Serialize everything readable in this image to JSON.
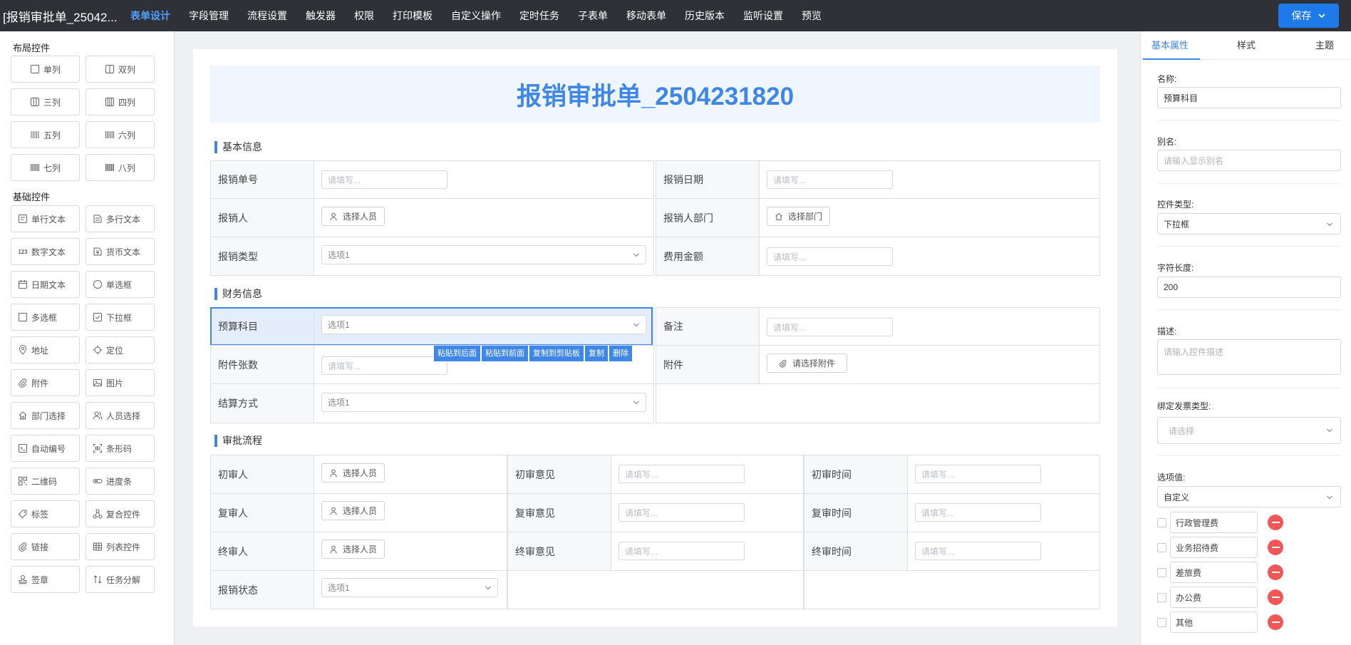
{
  "app": {
    "title": "[报销审批单_25042..."
  },
  "nav": [
    {
      "label": "表单设计",
      "active": true
    },
    {
      "label": "字段管理"
    },
    {
      "label": "流程设置"
    },
    {
      "label": "触发器"
    },
    {
      "label": "权限"
    },
    {
      "label": "打印模板"
    },
    {
      "label": "自定义操作"
    },
    {
      "label": "定时任务"
    },
    {
      "label": "子表单"
    },
    {
      "label": "移动表单"
    },
    {
      "label": "历史版本"
    },
    {
      "label": "监听设置"
    },
    {
      "label": "预览"
    }
  ],
  "save_label": "保存",
  "left": {
    "layout_title": "布局控件",
    "layout_items": [
      {
        "label": "单列",
        "icon": "single-column-icon"
      },
      {
        "label": "双列",
        "icon": "two-column-icon"
      },
      {
        "label": "三列",
        "icon": "three-column-icon"
      },
      {
        "label": "四列",
        "icon": "four-column-icon"
      },
      {
        "label": "五列",
        "icon": "five-column-icon"
      },
      {
        "label": "六列",
        "icon": "six-column-icon"
      },
      {
        "label": "七列",
        "icon": "seven-column-icon"
      },
      {
        "label": "八列",
        "icon": "eight-column-icon"
      }
    ],
    "basic_title": "基础控件",
    "basic_items": [
      {
        "label": "单行文本",
        "icon": "single-line-text-icon"
      },
      {
        "label": "多行文本",
        "icon": "multi-line-text-icon"
      },
      {
        "label": "数字文本",
        "icon": "number-icon",
        "glyph": "123"
      },
      {
        "label": "货币文本",
        "icon": "currency-icon"
      },
      {
        "label": "日期文本",
        "icon": "calendar-icon"
      },
      {
        "label": "单选框",
        "icon": "radio-icon"
      },
      {
        "label": "多选框",
        "icon": "checkbox-icon"
      },
      {
        "label": "下拉框",
        "icon": "dropdown-icon"
      },
      {
        "label": "地址",
        "icon": "location-pin-icon"
      },
      {
        "label": "定位",
        "icon": "crosshair-icon"
      },
      {
        "label": "附件",
        "icon": "paperclip-icon"
      },
      {
        "label": "图片",
        "icon": "image-icon"
      },
      {
        "label": "部门选择",
        "icon": "home-icon"
      },
      {
        "label": "人员选择",
        "icon": "users-icon"
      },
      {
        "label": "自动编号",
        "icon": "auto-number-icon"
      },
      {
        "label": "条形码",
        "icon": "barcode-icon"
      },
      {
        "label": "二维码",
        "icon": "qrcode-icon"
      },
      {
        "label": "进度条",
        "icon": "progress-icon"
      },
      {
        "label": "标签",
        "icon": "tag-icon"
      },
      {
        "label": "复合控件",
        "icon": "composite-icon"
      },
      {
        "label": "链接",
        "icon": "link-icon"
      },
      {
        "label": "列表控件",
        "icon": "table-icon"
      },
      {
        "label": "签章",
        "icon": "stamp-icon"
      },
      {
        "label": "任务分解",
        "icon": "task-split-icon"
      }
    ]
  },
  "form": {
    "title": "报销审批单_2504231820",
    "sections": {
      "basic": "基本信息",
      "finance": "财务信息",
      "approval": "审批流程"
    },
    "placeholder": "请填写...",
    "option1": "选项1",
    "pick_person": "选择人员",
    "pick_dept": "选择部门",
    "pick_attach": "请选择附件",
    "labels": {
      "no": "报销单号",
      "date": "报销日期",
      "person": "报销人",
      "dept": "报销人部门",
      "type": "报销类型",
      "amount": "费用金额",
      "budget": "预算科目",
      "remark": "备注",
      "attach_count": "附件张数",
      "attach": "附件",
      "settle": "结算方式",
      "first_approver": "初审人",
      "first_opinion": "初审意见",
      "first_time": "初审时间",
      "second_approver": "复审人",
      "second_opinion": "复审意见",
      "second_time": "复审时间",
      "final_approver": "终审人",
      "final_opinion": "终审意见",
      "final_time": "终审时间",
      "status": "报销状态"
    },
    "context_actions": [
      "粘贴到后面",
      "粘贴到前面",
      "复制到剪贴板",
      "复制",
      "删除"
    ]
  },
  "right": {
    "tabs": [
      {
        "label": "基本属性",
        "active": true
      },
      {
        "label": "样式"
      },
      {
        "label": "主题"
      }
    ],
    "name_label": "名称:",
    "name_value": "预算科目",
    "alias_label": "别名:",
    "alias_placeholder": "请输入显示别名",
    "type_label": "控件类型:",
    "type_value": "下拉框",
    "length_label": "字符长度:",
    "length_value": "200",
    "desc_label": "描述:",
    "desc_placeholder": "请输入控件描述",
    "invoice_label": "绑定发票类型:",
    "invoice_placeholder": "请选择",
    "options_label": "选项值:",
    "options_mode": "自定义",
    "options": [
      "行政管理费",
      "业务招待费",
      "差旅费",
      "办公费",
      "其他"
    ]
  },
  "colors": {
    "accent": "#3e86e8",
    "topbar": "#2f3136",
    "delete": "#f05858"
  }
}
